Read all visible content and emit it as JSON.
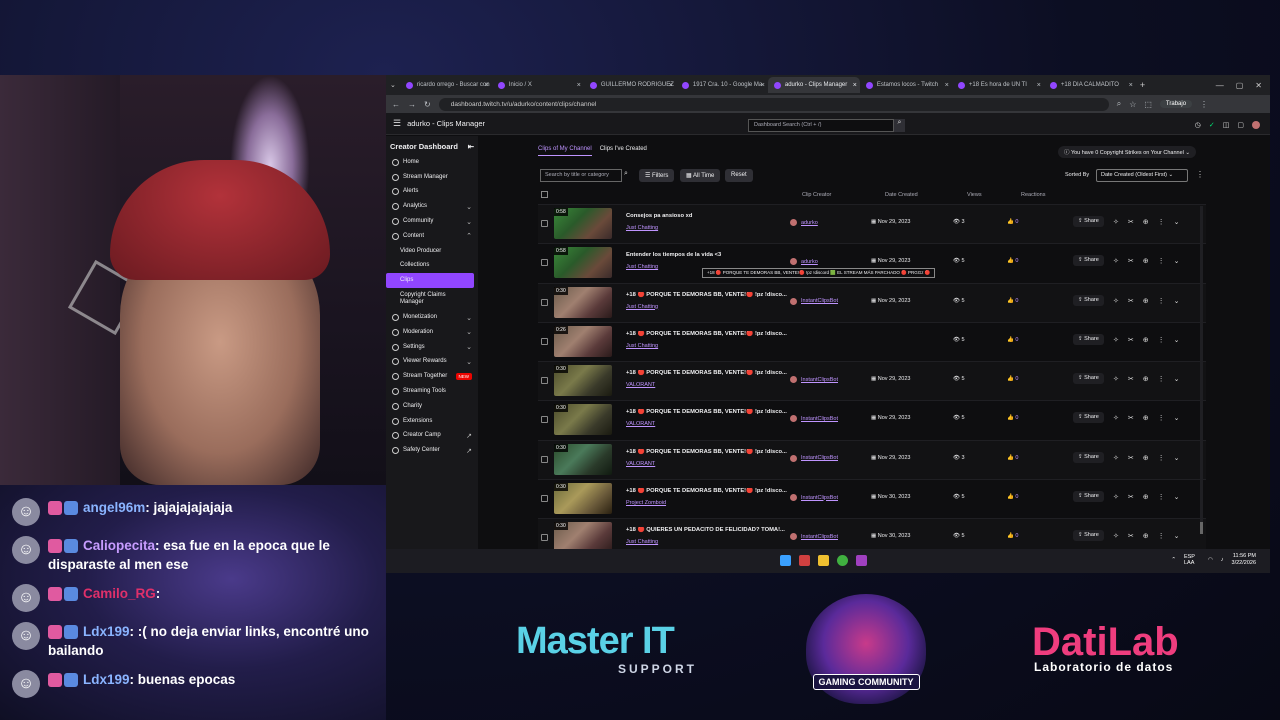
{
  "browser": {
    "tabs": [
      {
        "label": "ricardo orrego - Buscar con",
        "active": false
      },
      {
        "label": "Inicio / X",
        "active": false
      },
      {
        "label": "GUILLERMO RODRIGUEZ",
        "active": false
      },
      {
        "label": "1917 Cra. 10 - Google Ma",
        "active": false
      },
      {
        "label": "adurko - Clips Manager",
        "active": true
      },
      {
        "label": "Estamos locos - Twitch",
        "active": false
      },
      {
        "label": "+18 Es hora de UN TI",
        "active": false
      },
      {
        "label": "+18 DIA CALMADITO",
        "active": false
      }
    ],
    "url": "dashboard.twitch.tv/u/adurko/content/clips/channel",
    "profile": "Trabajo"
  },
  "header": {
    "title": "adurko - Clips Manager",
    "search_placeholder": "Dashboard Search (Ctrl + /)"
  },
  "sidebar": {
    "title": "Creator Dashboard",
    "items": [
      {
        "label": "Home",
        "sub": false,
        "chev": ""
      },
      {
        "label": "Stream Manager",
        "sub": false,
        "chev": ""
      },
      {
        "label": "Alerts",
        "sub": false,
        "chev": ""
      },
      {
        "label": "Analytics",
        "sub": false,
        "chev": "⌄"
      },
      {
        "label": "Community",
        "sub": false,
        "chev": "⌄"
      },
      {
        "label": "Content",
        "sub": false,
        "chev": "⌃"
      },
      {
        "label": "Video Producer",
        "sub": true,
        "chev": ""
      },
      {
        "label": "Collections",
        "sub": true,
        "chev": ""
      },
      {
        "label": "Clips",
        "sub": true,
        "chev": "",
        "active": true
      },
      {
        "label": "Copyright Claims Manager",
        "sub": true,
        "chev": ""
      },
      {
        "label": "Monetization",
        "sub": false,
        "chev": "⌄"
      },
      {
        "label": "Moderation",
        "sub": false,
        "chev": "⌄"
      },
      {
        "label": "Settings",
        "sub": false,
        "chev": "⌄"
      },
      {
        "label": "Viewer Rewards",
        "sub": false,
        "chev": "⌄"
      },
      {
        "label": "Stream Together",
        "sub": false,
        "chev": "",
        "badge": "NEW"
      },
      {
        "label": "Streaming Tools",
        "sub": false,
        "chev": ""
      },
      {
        "label": "Charity",
        "sub": false,
        "chev": ""
      },
      {
        "label": "Extensions",
        "sub": false,
        "chev": ""
      },
      {
        "label": "Creator Camp",
        "sub": false,
        "chev": "↗"
      },
      {
        "label": "Safety Center",
        "sub": false,
        "chev": "↗"
      }
    ]
  },
  "clips": {
    "tabs": [
      "Clips of My Channel",
      "Clips I've Created"
    ],
    "copyright": "You have 0 Copyright Strikes on Your Channel",
    "search_placeholder": "Search by title or category",
    "filters_label": "Filters",
    "all_time_label": "All Time",
    "reset_label": "Reset",
    "sorted_by_label": "Sorted By",
    "sort_value": "Date Created (Oldest First)",
    "columns": {
      "creator": "Clip Creator",
      "date": "Date Created",
      "views": "Views",
      "reactions": "Reactions"
    },
    "share_label": "Share",
    "tooltip": "+18 🔴 PORQUE TE DEMORAS BB, VENTE!🔴 !pz !discord 🟩 EL STREAM MÁS PARCHADO 🔴 PRGGz 🔴",
    "rows": [
      {
        "dur": "0:58",
        "title": "Consejos pa ansioso xd",
        "category": "Just Chatting",
        "creator": "adurko",
        "date": "Nov 29, 2023",
        "views": "3",
        "reactions": "0",
        "thumb": ""
      },
      {
        "dur": "0:58",
        "title": "Entender los tiempos de la vida <3",
        "category": "Just Chatting",
        "creator": "adurko",
        "date": "Nov 29, 2023",
        "views": "5",
        "reactions": "0",
        "thumb": ""
      },
      {
        "dur": "0:30",
        "title": "+18 🔴 PORQUE TE DEMORAS BB, VENTE!🔴 !pz !disco...",
        "category": "Just Chatting",
        "creator": "InstantClipsBot",
        "date": "Nov 29, 2023",
        "views": "5",
        "reactions": "0",
        "thumb": "g2"
      },
      {
        "dur": "0:26",
        "title": "+18 🔴 PORQUE TE DEMORAS BB, VENTE!🔴 !pz !disco...",
        "category": "Just Chatting",
        "creator": "",
        "date": "",
        "views": "5",
        "reactions": "0",
        "thumb": "g2"
      },
      {
        "dur": "0:30",
        "title": "+18 🔴 PORQUE TE DEMORAS BB, VENTE!🔴 !pz !disco...",
        "category": "VALORANT",
        "creator": "InstantClipsBot",
        "date": "Nov 29, 2023",
        "views": "5",
        "reactions": "0",
        "thumb": "g3"
      },
      {
        "dur": "0:30",
        "title": "+18 🔴 PORQUE TE DEMORAS BB, VENTE!🔴 !pz !disco...",
        "category": "VALORANT",
        "creator": "InstantClipsBot",
        "date": "Nov 29, 2023",
        "views": "5",
        "reactions": "0",
        "thumb": "g3"
      },
      {
        "dur": "0:30",
        "title": "+18 🔴 PORQUE TE DEMORAS BB, VENTE!🔴 !pz !disco...",
        "category": "VALORANT",
        "creator": "InstantClipsBot",
        "date": "Nov 29, 2023",
        "views": "3",
        "reactions": "0",
        "thumb": "g4"
      },
      {
        "dur": "0:30",
        "title": "+18 🔴 PORQUE TE DEMORAS BB, VENTE!🔴 !pz !disco...",
        "category": "Project Zomboid",
        "creator": "InstantClipsBot",
        "date": "Nov 30, 2023",
        "views": "5",
        "reactions": "0",
        "thumb": "g5"
      },
      {
        "dur": "0:30",
        "title": "+18 🔴 QUIERES UN PEDACITO DE FELICIDAD? TOMA!...",
        "category": "Just Chatting",
        "creator": "InstantClipsBot",
        "date": "Nov 30, 2023",
        "views": "5",
        "reactions": "0",
        "thumb": "g2"
      }
    ]
  },
  "taskbar": {
    "lang": "ESP LAA",
    "time": "11:56 PM",
    "date": "3/22/2026"
  },
  "chat": [
    {
      "user": "angel96m",
      "text": ": jajajajajajaja",
      "color": "#8ab4ff"
    },
    {
      "user": "Caliopecita",
      "text": ": esa fue en la epoca que le disparaste al men ese",
      "color": "#c79cff"
    },
    {
      "user": "Camilo_RG",
      "text": ":",
      "color": "#e0306a"
    },
    {
      "user": "Ldx199",
      "text": ": :( no deja enviar links, encontré uno bailando",
      "color": "#8ab4ff"
    },
    {
      "user": "Ldx199",
      "text": ": buenas epocas",
      "color": "#8ab4ff"
    }
  ],
  "sponsors": {
    "master": "Master IT",
    "master_sub": "SUPPORT",
    "pgc": "GAMING COMMUNITY",
    "dati": "DatiLab",
    "dati_sub": "Laboratorio de datos"
  }
}
